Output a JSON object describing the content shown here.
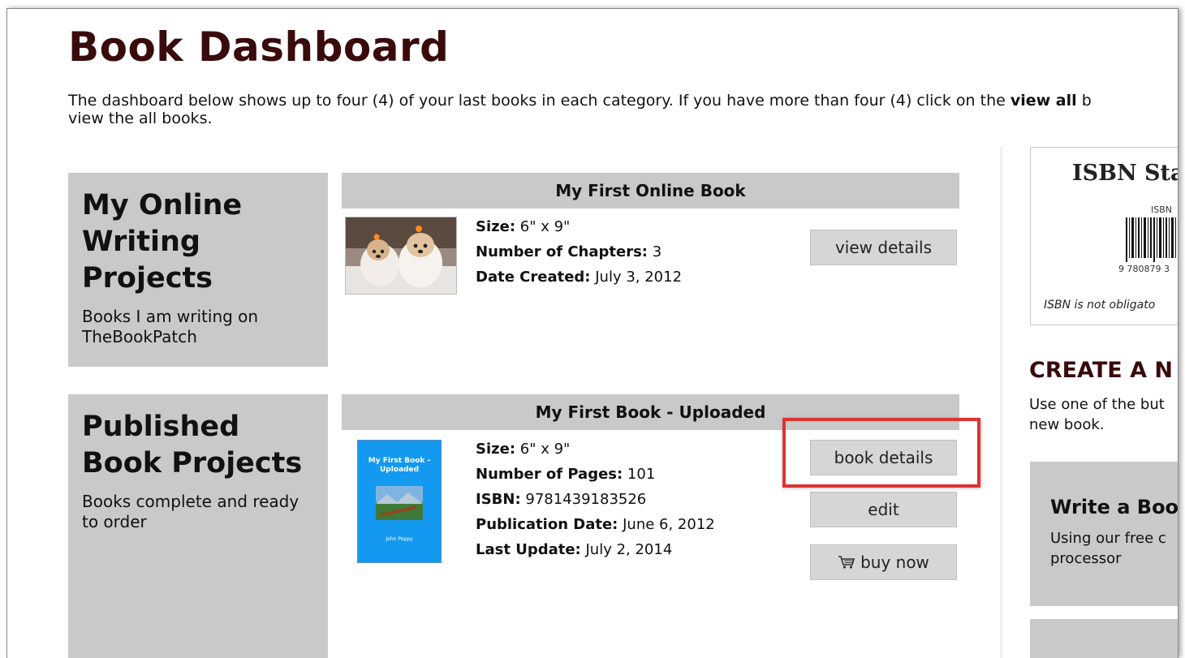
{
  "page": {
    "title": "Book Dashboard",
    "intro_before": "The dashboard below shows up to four (4) of your last books in each category. If you have more than four (4) click on the ",
    "intro_bold": "view all",
    "intro_after": " b",
    "intro_line2": "view the all books."
  },
  "online": {
    "category_title": "My Online Writing Projects",
    "category_subtitle": "Books I am writing on TheBookPatch",
    "book": {
      "title": "My First Online Book",
      "size_label": "Size:",
      "size_value": " 6\" x 9\"",
      "chapters_label": "Number of Chapters:",
      "chapters_value": " 3",
      "created_label": "Date Created:",
      "created_value": " July 3, 2012",
      "view_button": "view details"
    }
  },
  "published": {
    "category_title": "Published Book Projects",
    "category_subtitle": "Books complete and ready to order",
    "book": {
      "title": "My First Book - Uploaded",
      "cover_title": "My First Book - Uploaded",
      "cover_author": "John Poppy",
      "size_label": "Size:",
      "size_value": " 6\" x 9\"",
      "pages_label": "Number of Pages:",
      "pages_value": " 101",
      "isbn_label": "ISBN:",
      "isbn_value": " 9781439183526",
      "pubdate_label": "Publication Date:",
      "pubdate_value": " June 6, 2012",
      "update_label": "Last Update:",
      "update_value": " July 2, 2014",
      "details_button": "book details",
      "edit_button": "edit",
      "buy_button": "buy now"
    }
  },
  "sidebar": {
    "isbn_title": "ISBN Sta",
    "isbn_small": "ISBN",
    "isbn_number": "9  780879  3",
    "isbn_note": "ISBN is not obligato",
    "create_title": "CREATE A N",
    "create_desc": "Use one of the but new book.",
    "write_title": "Write a Boo",
    "write_desc_1": "Using our free c",
    "write_desc_2": "processor"
  },
  "icons": {
    "buy": "shopping-cart-icon"
  },
  "colors": {
    "heading": "#3a0b0b",
    "highlight": "#dd3333",
    "panel": "#c9c9c9",
    "cover": "#1499f0"
  }
}
